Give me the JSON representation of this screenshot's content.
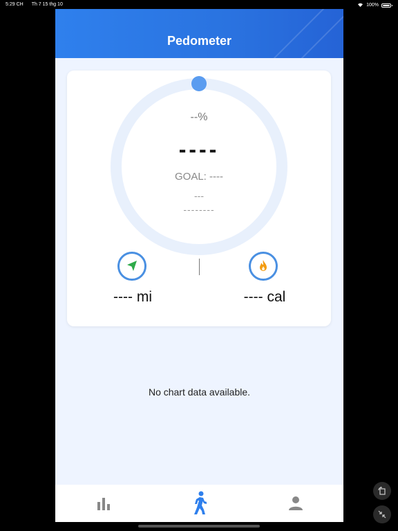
{
  "status_bar": {
    "time": "5:29 CH",
    "date": "Th 7 15 thg 10",
    "battery": "100%"
  },
  "header": {
    "title": "Pedometer"
  },
  "progress": {
    "percent": "--%",
    "steps": "----",
    "goal": "GOAL: ----",
    "line1": "---",
    "line2": "--------"
  },
  "stats": {
    "distance": "---- mi",
    "calories": "---- cal"
  },
  "chart": {
    "empty_message": "No chart data available."
  },
  "tabs": [
    {
      "icon": "bar-chart-icon",
      "active": false
    },
    {
      "icon": "walking-icon",
      "active": true
    },
    {
      "icon": "user-icon",
      "active": false
    }
  ],
  "colors": {
    "accent": "#2f80ed",
    "ring": "#e8f0fc",
    "ring_dot": "#5a9cf0",
    "distance_icon": "#2eaa4a",
    "calories_icon": "#f39c12",
    "tab_active": "#2f80ed",
    "tab_inactive": "#888888"
  }
}
